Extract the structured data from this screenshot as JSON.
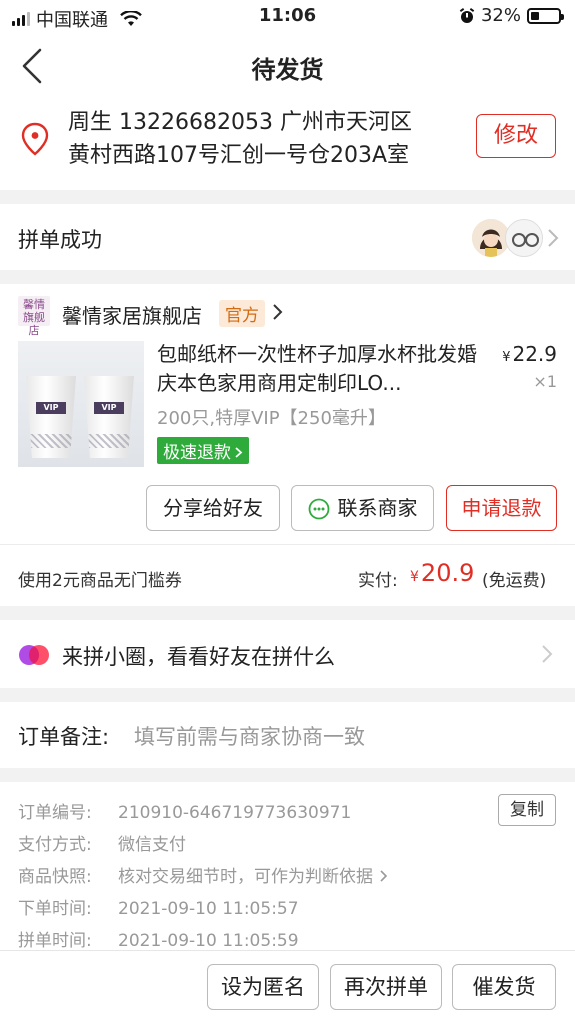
{
  "status_bar": {
    "carrier": "中国联通",
    "time": "11:06",
    "battery": "32%",
    "battery_level": 0.32
  },
  "nav": {
    "title": "待发货"
  },
  "address": {
    "line1": "周生  13226682053  广州市天河区",
    "line2": "黄村西路107号汇创一号仓203A室",
    "modify_label": "修改"
  },
  "group": {
    "title": "拼单成功"
  },
  "store": {
    "logo_text_1": "馨情",
    "logo_text_2": "旗舰店",
    "name": "馨情家居旗舰店",
    "badge": "官方",
    "product": {
      "image_text": "VIP",
      "title": "包邮纸杯一次性杯子加厚水杯批发婚庆本色家用商用定制印LO...",
      "price": "22.9",
      "currency": "¥",
      "qty": "×1",
      "spec": "200只,特厚VIP【250毫升】",
      "refund_tag": "极速退款"
    },
    "actions": {
      "share": "分享给好友",
      "contact": "联系商家",
      "refund": "申请退款"
    },
    "coupon": "使用2元商品无门槛券",
    "paid_label": "实付:",
    "paid_currency": "¥",
    "paid_amount": "20.9",
    "shipping_note": "(免运费)"
  },
  "circle_banner": {
    "text": "来拼小圈，看看好友在拼什么"
  },
  "remark": {
    "label": "订单备注:",
    "placeholder": "填写前需与商家协商一致"
  },
  "order_info": {
    "copy_label": "复制",
    "rows": [
      {
        "key": "订单编号:",
        "value": "210910-646719773630971"
      },
      {
        "key": "支付方式:",
        "value": "微信支付"
      },
      {
        "key": "商品快照:",
        "value": "核对交易细节时，可作为判断依据"
      },
      {
        "key": "下单时间:",
        "value": "2021-09-10 11:05:57"
      },
      {
        "key": "拼单时间:",
        "value": "2021-09-10 11:05:59"
      }
    ]
  },
  "bottom_bar": {
    "anonymous": "设为匿名",
    "again": "再次拼单",
    "urge": "催发货"
  },
  "colors": {
    "accent_red": "#e02e24",
    "refund_green": "#2fab3c",
    "official_orange": "#d36b13"
  }
}
